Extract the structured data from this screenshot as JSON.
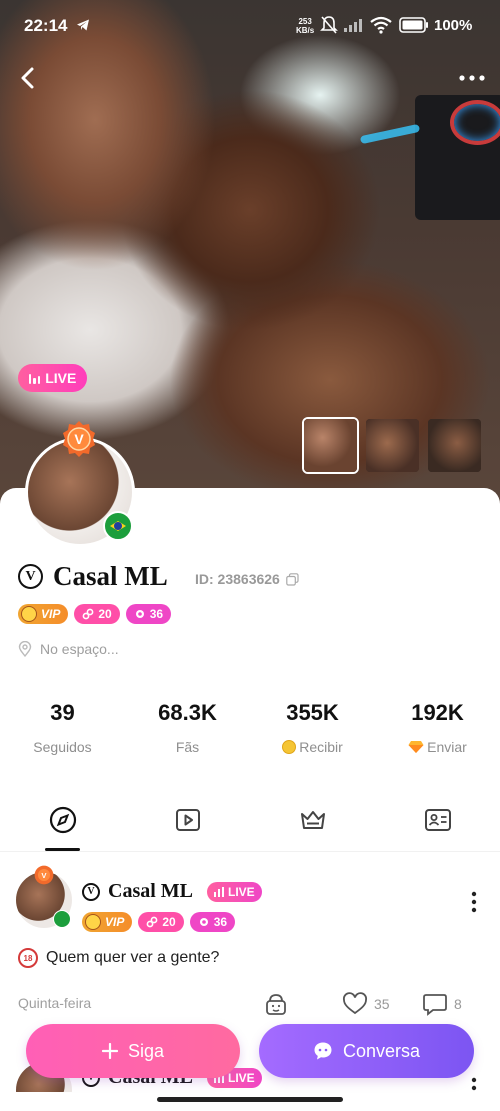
{
  "status_bar": {
    "time": "22:14",
    "net_speed_value": "253",
    "net_speed_unit": "KB/s",
    "battery": "100%"
  },
  "hero": {
    "live_label": "LIVE",
    "thumbnails": [
      "photo-1",
      "photo-2",
      "photo-3"
    ],
    "selected_thumbnail": 1
  },
  "profile": {
    "verified_mark": "V",
    "name": "Casal ML",
    "id_label": "ID: 23863626",
    "badges": {
      "vip": "VIP",
      "level_1": "20",
      "level_2": "36"
    },
    "location": "No espaço...",
    "country_flag": "brazil-flag-icon"
  },
  "stats": [
    {
      "value": "39",
      "label": "Seguidos",
      "icon": ""
    },
    {
      "value": "68.3K",
      "label": "Fãs",
      "icon": ""
    },
    {
      "value": "355K",
      "label": "Recibir",
      "icon": "coin-icon"
    },
    {
      "value": "192K",
      "label": "Enviar",
      "icon": "gem-icon"
    }
  ],
  "tabs": [
    {
      "name": "moments",
      "icon": "compass-icon",
      "active": true
    },
    {
      "name": "videos",
      "icon": "play-icon",
      "active": false
    },
    {
      "name": "privileges",
      "icon": "crown-icon",
      "active": false
    },
    {
      "name": "profile-info",
      "icon": "id-card-icon",
      "active": false
    }
  ],
  "post": {
    "author": "Casal ML",
    "live_label": "LIVE",
    "badges": {
      "vip": "VIP",
      "level_1": "20",
      "level_2": "36"
    },
    "text": "Quem quer ver a gente?",
    "age_icon": "18",
    "date": "Quinta-feira",
    "likes": "35",
    "comments": "8"
  },
  "post_2": {
    "author": "Casal ML",
    "live_label": "LIVE"
  },
  "actions": {
    "follow_label": "Siga",
    "chat_label": "Conversa"
  },
  "colors": {
    "live_pink": "#ff4fa8",
    "level_magenta": "#ef46c6",
    "vip_orange": "#f0a531",
    "chat_purple": "#8a5cf6"
  }
}
